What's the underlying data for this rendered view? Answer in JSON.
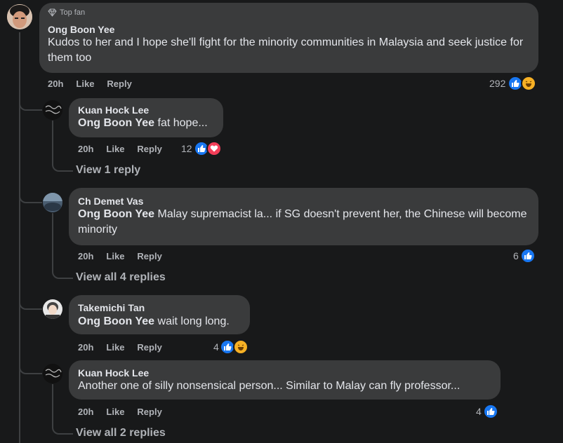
{
  "root": {
    "badge": "Top fan",
    "author": "Ong Boon Yee",
    "text": "Kudos to her and I hope she'll fight for the minority communities in Malaysia and seek justice for them too",
    "time": "20h",
    "like": "Like",
    "reply": "Reply",
    "reactions": "292"
  },
  "replies": [
    {
      "author": "Kuan Hock Lee",
      "tag": "Ong Boon Yee",
      "text": " fat hope...",
      "time": "20h",
      "like": "Like",
      "reply": "Reply",
      "reactions": "12",
      "view_replies": "View 1 reply"
    },
    {
      "author": "Ch Demet Vas",
      "tag": "Ong Boon Yee",
      "text": " Malay supremacist la... if SG doesn't prevent her, the Chinese will become minority",
      "time": "20h",
      "like": "Like",
      "reply": "Reply",
      "reactions": "6",
      "view_replies": "View all 4 replies"
    },
    {
      "author": "Takemichi Tan",
      "tag": "Ong Boon Yee",
      "text": " wait long long.",
      "time": "20h",
      "like": "Like",
      "reply": "Reply",
      "reactions": "4"
    },
    {
      "author": "Kuan Hock Lee",
      "text": "Another one of silly nonsensical person... Similar to Malay can fly professor...",
      "time": "20h",
      "like": "Like",
      "reply": "Reply",
      "reactions": "4",
      "view_replies": "View all 2 replies"
    }
  ],
  "colors": {
    "background": "#18191a",
    "bubble": "#3a3b3c",
    "like": "#1877f2",
    "love": "#f33e58",
    "haha": "#f7b125"
  }
}
